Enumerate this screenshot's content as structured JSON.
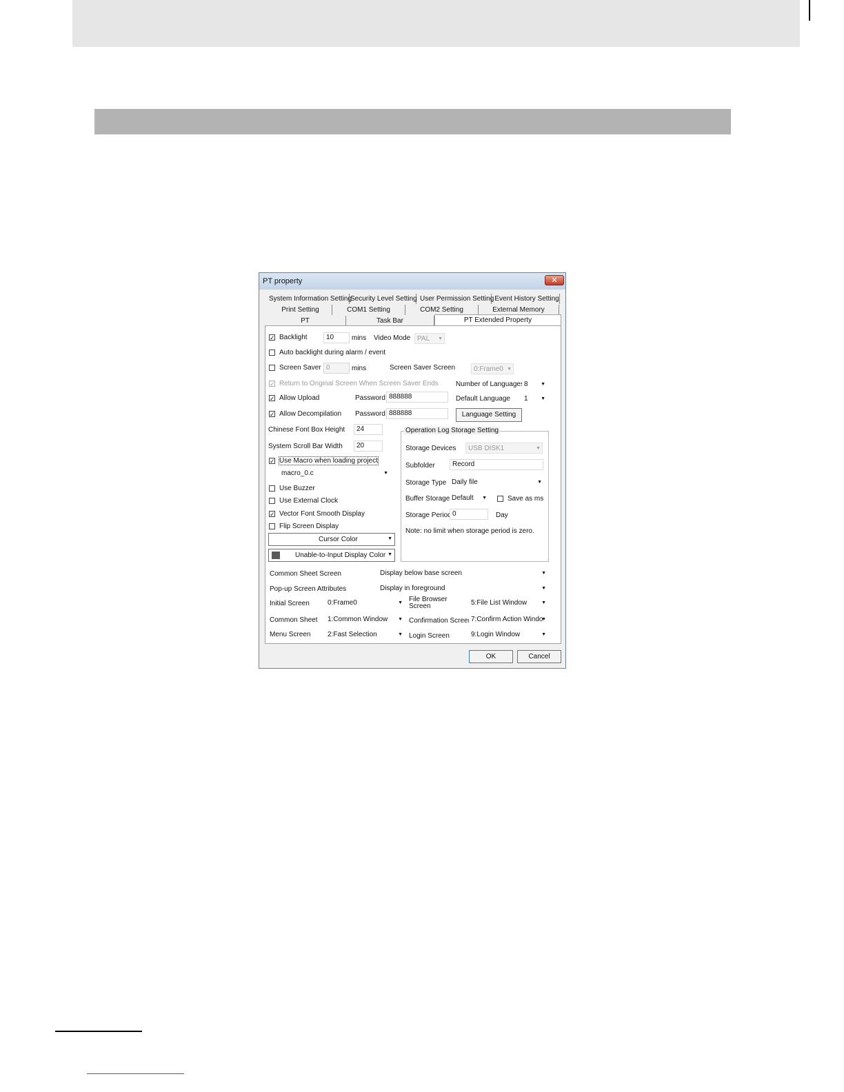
{
  "dialog": {
    "title": "PT property",
    "close_glyph": "✕",
    "tabs_row1": [
      "System Information Setting",
      "Security Level Setting",
      "User Permission Setting",
      "Event History Setting"
    ],
    "tabs_row2": [
      "Print Setting",
      "COM1 Setting",
      "COM2 Setting",
      "External Memory"
    ],
    "tabs_row3": [
      "PT",
      "Task Bar",
      "PT Extended Property"
    ],
    "active_tab": "PT Extended Property"
  },
  "form": {
    "backlight": {
      "label": "Backlight",
      "checked": true,
      "value": "10",
      "unit": "mins"
    },
    "video_mode": {
      "label": "Video Mode",
      "value": "PAL"
    },
    "auto_backlight": {
      "label": "Auto backlight during alarm / event",
      "checked": false
    },
    "screen_saver": {
      "label": "Screen Saver",
      "checked": false,
      "value": "0",
      "unit": "mins"
    },
    "screen_saver_screen": {
      "label": "Screen Saver Screen",
      "value": "0:Frame0"
    },
    "return_original": {
      "label": "Return to Original Screen When Screen Saver Ends",
      "checked": true
    },
    "num_languages": {
      "label": "Number of Languages",
      "value": "8"
    },
    "default_language": {
      "label": "Default Language",
      "value": "1"
    },
    "allow_upload": {
      "label": "Allow Upload",
      "checked": true,
      "password_label": "Password",
      "password": "888888"
    },
    "allow_decompilation": {
      "label": "Allow Decompilation",
      "checked": true,
      "password_label": "Password",
      "password": "888888"
    },
    "language_setting_button": "Language Setting",
    "chinese_font_box_height": {
      "label": "Chinese Font Box Height",
      "value": "24"
    },
    "system_scroll_bar_width": {
      "label": "System Scroll Bar Width",
      "value": "20"
    },
    "use_macro": {
      "label": "Use Macro when loading project",
      "checked": true,
      "value": "macro_0.c"
    },
    "use_buzzer": {
      "label": "Use Buzzer",
      "checked": false
    },
    "use_external_clock": {
      "label": "Use External Clock",
      "checked": false
    },
    "vector_font_smooth": {
      "label": "Vector Font Smooth Display",
      "checked": true
    },
    "flip_screen": {
      "label": "Flip Screen Display",
      "checked": false
    },
    "cursor_color": {
      "label": "Cursor Color",
      "swatch": "#ffffff"
    },
    "unable_color": {
      "label": "Unable-to-Input Display Color",
      "swatch": "#5a5a5a"
    },
    "oplog": {
      "title": "Operation Log Storage Setting",
      "storage_devices": {
        "label": "Storage Devices",
        "value": "USB DISK1"
      },
      "subfolder": {
        "label": "Subfolder",
        "value": "Record"
      },
      "storage_type": {
        "label": "Storage Type",
        "value": "Daily file"
      },
      "buffer_storage": {
        "label": "Buffer Storage",
        "value": "Default"
      },
      "save_as_ms": {
        "label": "Save as ms",
        "checked": false
      },
      "storage_period": {
        "label": "Storage Period",
        "value": "0",
        "unit": "Day"
      },
      "note": "Note: no limit when storage period is zero."
    },
    "common_sheet_screen": {
      "label": "Common Sheet Screen",
      "value": "Display below base screen"
    },
    "popup_attributes": {
      "label": "Pop-up Screen Attributes",
      "value": "Display in foreground"
    },
    "initial_screen": {
      "label": "Initial Screen",
      "value": "0:Frame0"
    },
    "file_browser_screen": {
      "label1": "File Browser",
      "label2": "Screen",
      "value": "5:File List Window"
    },
    "common_sheet": {
      "label": "Common Sheet",
      "value": "1:Common Window"
    },
    "confirmation_screen": {
      "label": "Confirmation Screen",
      "value": "7:Confirm Action Windo"
    },
    "menu_screen": {
      "label": "Menu Screen",
      "value": "2:Fast Selection"
    },
    "login_screen": {
      "label": "Login Screen",
      "value": "9:Login Window"
    },
    "ok_button": "OK",
    "cancel_button": "Cancel",
    "check_glyph": "✓",
    "arrow_glyph": "▼"
  }
}
